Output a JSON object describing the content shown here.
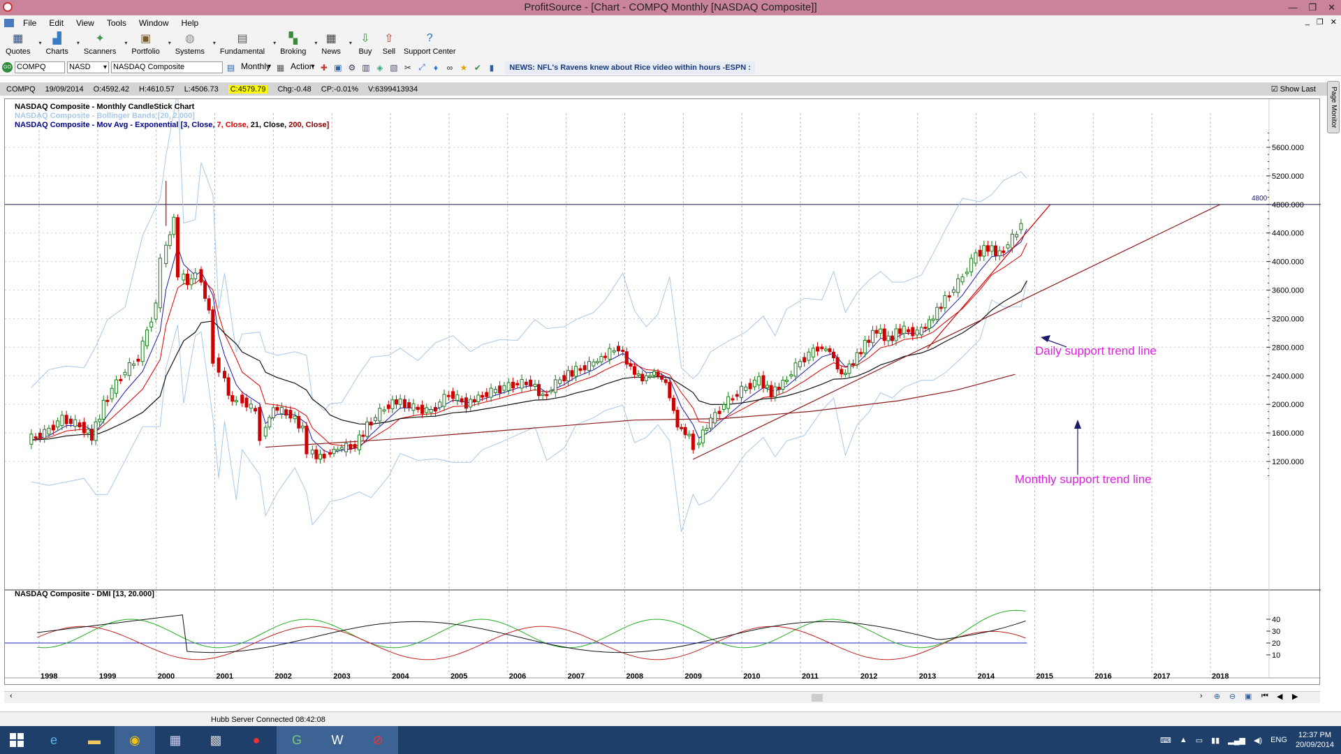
{
  "window": {
    "title": "ProfitSource - [Chart - COMPQ Monthly [NASDAQ Composite]]"
  },
  "menu": [
    "File",
    "Edit",
    "View",
    "Tools",
    "Window",
    "Help"
  ],
  "toolbar": [
    {
      "label": "Quotes",
      "icon": "quotes-icon",
      "glyph": "▦",
      "color": "#2b4a7a",
      "dd": true
    },
    {
      "label": "Charts",
      "icon": "charts-icon",
      "glyph": "▟",
      "color": "#3a7bc8",
      "dd": true
    },
    {
      "label": "Scanners",
      "icon": "scanners-icon",
      "glyph": "✦",
      "color": "#3a9a4a",
      "dd": true
    },
    {
      "label": "Portfolio",
      "icon": "portfolio-icon",
      "glyph": "▣",
      "color": "#7a5a2a",
      "dd": true
    },
    {
      "label": "Systems",
      "icon": "systems-icon",
      "glyph": "◍",
      "color": "#888888",
      "dd": true
    },
    {
      "label": "Fundamental",
      "icon": "fundamental-icon",
      "glyph": "▤",
      "color": "#555555",
      "dd": true
    },
    {
      "label": "Broking",
      "icon": "broking-icon",
      "glyph": "▚",
      "color": "#3a8a3a",
      "dd": true
    },
    {
      "label": "News",
      "icon": "news-icon",
      "glyph": "▦",
      "color": "#444444",
      "dd": true
    },
    {
      "label": "Buy",
      "icon": "buy-icon",
      "glyph": "⇩",
      "color": "#2e9b3a",
      "dd": false
    },
    {
      "label": "Sell",
      "icon": "sell-icon",
      "glyph": "⇧",
      "color": "#c0392b",
      "dd": false
    },
    {
      "label": "Support Center",
      "icon": "help-icon",
      "glyph": "?",
      "color": "#1f6fc0",
      "dd": false
    }
  ],
  "security": {
    "code": "COMPQ",
    "exchange": "NASD",
    "name": "NASDAQ Composite",
    "period": "Monthly",
    "action": "Action",
    "news": "NEWS: NFL's Ravens knew about Rice video within hours -ESPN :"
  },
  "quote": {
    "code": "COMPQ",
    "date": "19/09/2014",
    "open": "O:4592.42",
    "high": "H:4610.57",
    "low": "L:4506.73",
    "close": "C:4579.79",
    "chg": "Chg:-0.48",
    "cp": "CP:-0.01%",
    "volume": "V:6399413934",
    "show_last": "Show Last"
  },
  "page_monitor": "Page Monitor",
  "legend": {
    "l1": "NASDAQ Composite - Monthly CandleStick Chart",
    "l2": "NASDAQ Composite - Bollinger Bands [20, 2.000]",
    "l3a": "NASDAQ Composite - Mov Avg - Exponential [3, Close, ",
    "l3b": "7, Close, ",
    "l3c": "21, Close, ",
    "l3d": "200, Close]",
    "dmi": "NASDAQ Composite - DMI [13, 20.000]"
  },
  "annotations": {
    "daily": "Daily support trend line",
    "monthly": "Monthly support trend line",
    "level": "4800"
  },
  "chart_data": {
    "type": "candlestick",
    "y_ticks": [
      "5600.000",
      "5200.000",
      "4800.000",
      "4400.000",
      "4000.000",
      "3600.000",
      "3200.000",
      "2800.000",
      "2400.000",
      "2000.000",
      "1600.000",
      "1200.000"
    ],
    "x_labels": [
      "1998",
      "1999",
      "2000",
      "2001",
      "2002",
      "2003",
      "2004",
      "2005",
      "2006",
      "2007",
      "2008",
      "2009",
      "2010",
      "2011",
      "2012",
      "2013",
      "2014",
      "2015",
      "2016",
      "2017",
      "2018"
    ],
    "ylim": [
      1000,
      5900
    ],
    "dmi_ticks": [
      "40",
      "30",
      "20",
      "10"
    ],
    "dmi_ylim": [
      0,
      48
    ],
    "horizontal_line": 4800,
    "close_path": [
      [
        1997.7,
        1500
      ],
      [
        1998.0,
        1600
      ],
      [
        1998.3,
        1800
      ],
      [
        1998.6,
        1700
      ],
      [
        1998.8,
        1550
      ],
      [
        1999.0,
        2000
      ],
      [
        1999.3,
        2400
      ],
      [
        1999.6,
        2650
      ],
      [
        1999.9,
        3400
      ],
      [
        2000.0,
        4000
      ],
      [
        2000.2,
        4600
      ],
      [
        2000.3,
        3800
      ],
      [
        2000.5,
        3700
      ],
      [
        2000.6,
        3900
      ],
      [
        2000.8,
        3300
      ],
      [
        2000.9,
        2600
      ],
      [
        2001.0,
        2500
      ],
      [
        2001.2,
        2000
      ],
      [
        2001.3,
        2100
      ],
      [
        2001.6,
        1900
      ],
      [
        2001.7,
        1550
      ],
      [
        2001.9,
        1950
      ],
      [
        2002.2,
        1850
      ],
      [
        2002.4,
        1650
      ],
      [
        2002.5,
        1350
      ],
      [
        2002.7,
        1250
      ],
      [
        2002.8,
        1300
      ],
      [
        2003.0,
        1380
      ],
      [
        2003.3,
        1420
      ],
      [
        2003.5,
        1700
      ],
      [
        2003.8,
        1950
      ],
      [
        2004.0,
        2050
      ],
      [
        2004.3,
        1950
      ],
      [
        2004.6,
        1900
      ],
      [
        2004.9,
        2150
      ],
      [
        2005.2,
        2000
      ],
      [
        2005.4,
        2100
      ],
      [
        2005.7,
        2200
      ],
      [
        2006.0,
        2280
      ],
      [
        2006.3,
        2300
      ],
      [
        2006.5,
        2100
      ],
      [
        2006.8,
        2350
      ],
      [
        2007.0,
        2450
      ],
      [
        2007.3,
        2550
      ],
      [
        2007.5,
        2650
      ],
      [
        2007.8,
        2800
      ],
      [
        2008.0,
        2500
      ],
      [
        2008.2,
        2350
      ],
      [
        2008.4,
        2450
      ],
      [
        2008.6,
        2300
      ],
      [
        2008.8,
        1700
      ],
      [
        2009.0,
        1550
      ],
      [
        2009.1,
        1400
      ],
      [
        2009.3,
        1700
      ],
      [
        2009.6,
        2000
      ],
      [
        2009.9,
        2200
      ],
      [
        2010.2,
        2350
      ],
      [
        2010.4,
        2150
      ],
      [
        2010.6,
        2300
      ],
      [
        2010.9,
        2600
      ],
      [
        2011.2,
        2800
      ],
      [
        2011.4,
        2750
      ],
      [
        2011.6,
        2400
      ],
      [
        2011.8,
        2600
      ],
      [
        2012.0,
        2850
      ],
      [
        2012.2,
        3050
      ],
      [
        2012.4,
        2900
      ],
      [
        2012.6,
        3050
      ],
      [
        2012.9,
        3000
      ],
      [
        2013.1,
        3150
      ],
      [
        2013.3,
        3400
      ],
      [
        2013.6,
        3700
      ],
      [
        2013.9,
        4100
      ],
      [
        2014.1,
        4200
      ],
      [
        2014.3,
        4100
      ],
      [
        2014.6,
        4400
      ],
      [
        2014.7,
        4580
      ]
    ]
  }
}
